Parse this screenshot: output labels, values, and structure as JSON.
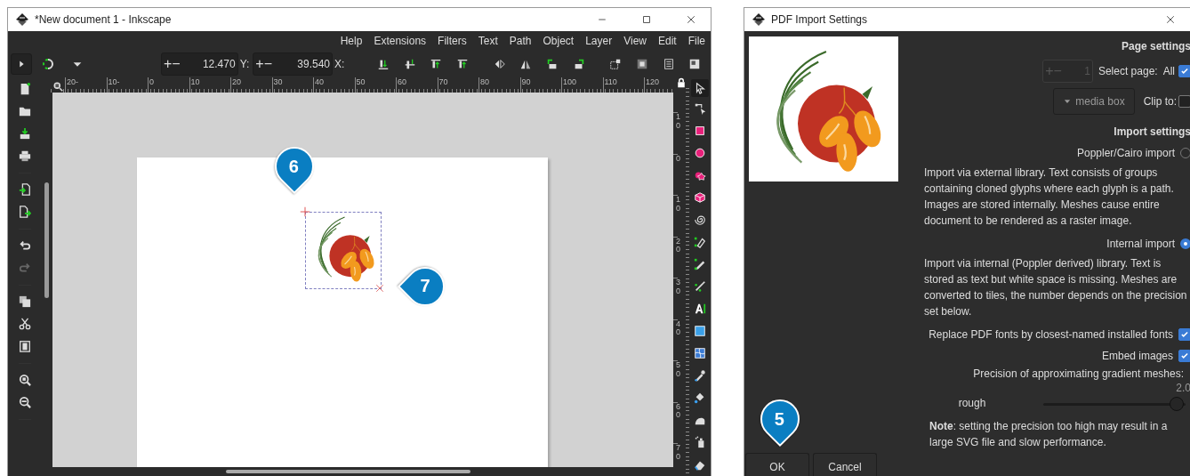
{
  "editor_window": {
    "title": "*New document 1 - Inkscape",
    "menu": [
      "Help",
      "Extensions",
      "Filters",
      "Text",
      "Path",
      "Object",
      "Layer",
      "View",
      "Edit",
      "File"
    ],
    "toolbar": {
      "fields": [
        {
          "plus": "+",
          "minus": "−",
          "value": "12.470",
          "label": "Y:"
        },
        {
          "plus": "+",
          "minus": "−",
          "value": "39.540",
          "label": "X:"
        }
      ]
    },
    "ruler": {
      "horizontal": [
        "20-",
        "10-",
        "0",
        "10",
        "20",
        "30",
        "40",
        "50",
        "60",
        "70",
        "80",
        "90",
        "100",
        "110",
        "120"
      ],
      "vertical": [
        "10",
        "0",
        "10",
        "20",
        "30",
        "40",
        "50",
        "60",
        "70"
      ]
    },
    "canvas": {
      "markers": [
        {
          "label": "6",
          "kind": "down"
        },
        {
          "label": "7",
          "kind": "left"
        }
      ]
    }
  },
  "import_dialog": {
    "title": "PDF Import Settings",
    "page_settings": {
      "heading": "Page settings",
      "page_spinner": {
        "plus": "+",
        "minus": "−",
        "value": "1",
        "disabled": true
      },
      "select_page_label": "Select page:",
      "all": {
        "label": "All",
        "checked": true
      },
      "page_box": {
        "value": "media box"
      },
      "clip_to": {
        "label": "Clip to:",
        "checked": false
      }
    },
    "import_settings": {
      "heading": "Import settings",
      "methods": [
        {
          "label": "Poppler/Cairo import",
          "selected": false,
          "description": "Import via external library. Text consists of groups containing cloned glyphs where each glyph is a path. Images are stored internally. Meshes cause entire document to be rendered as a raster image."
        },
        {
          "label": "Internal import",
          "selected": true,
          "description": "Import via internal (Poppler derived) library. Text is stored as text but white space is missing. Meshes are converted to tiles, the number depends on the precision set below."
        }
      ],
      "options": [
        {
          "label": "Replace PDF fonts by closest-named installed fonts",
          "checked": true
        },
        {
          "label": "Embed images",
          "checked": true
        }
      ],
      "precision": {
        "label": "Precision of approximating gradient meshes:",
        "min_label": "rough",
        "reading": "2.0",
        "level": 0.94
      },
      "note": "**Note**: setting the precision too high may result in a large SVG file and slow performance."
    },
    "buttons": [
      "OK",
      "Cancel"
    ],
    "marker": {
      "label": "5",
      "kind": "down"
    }
  }
}
